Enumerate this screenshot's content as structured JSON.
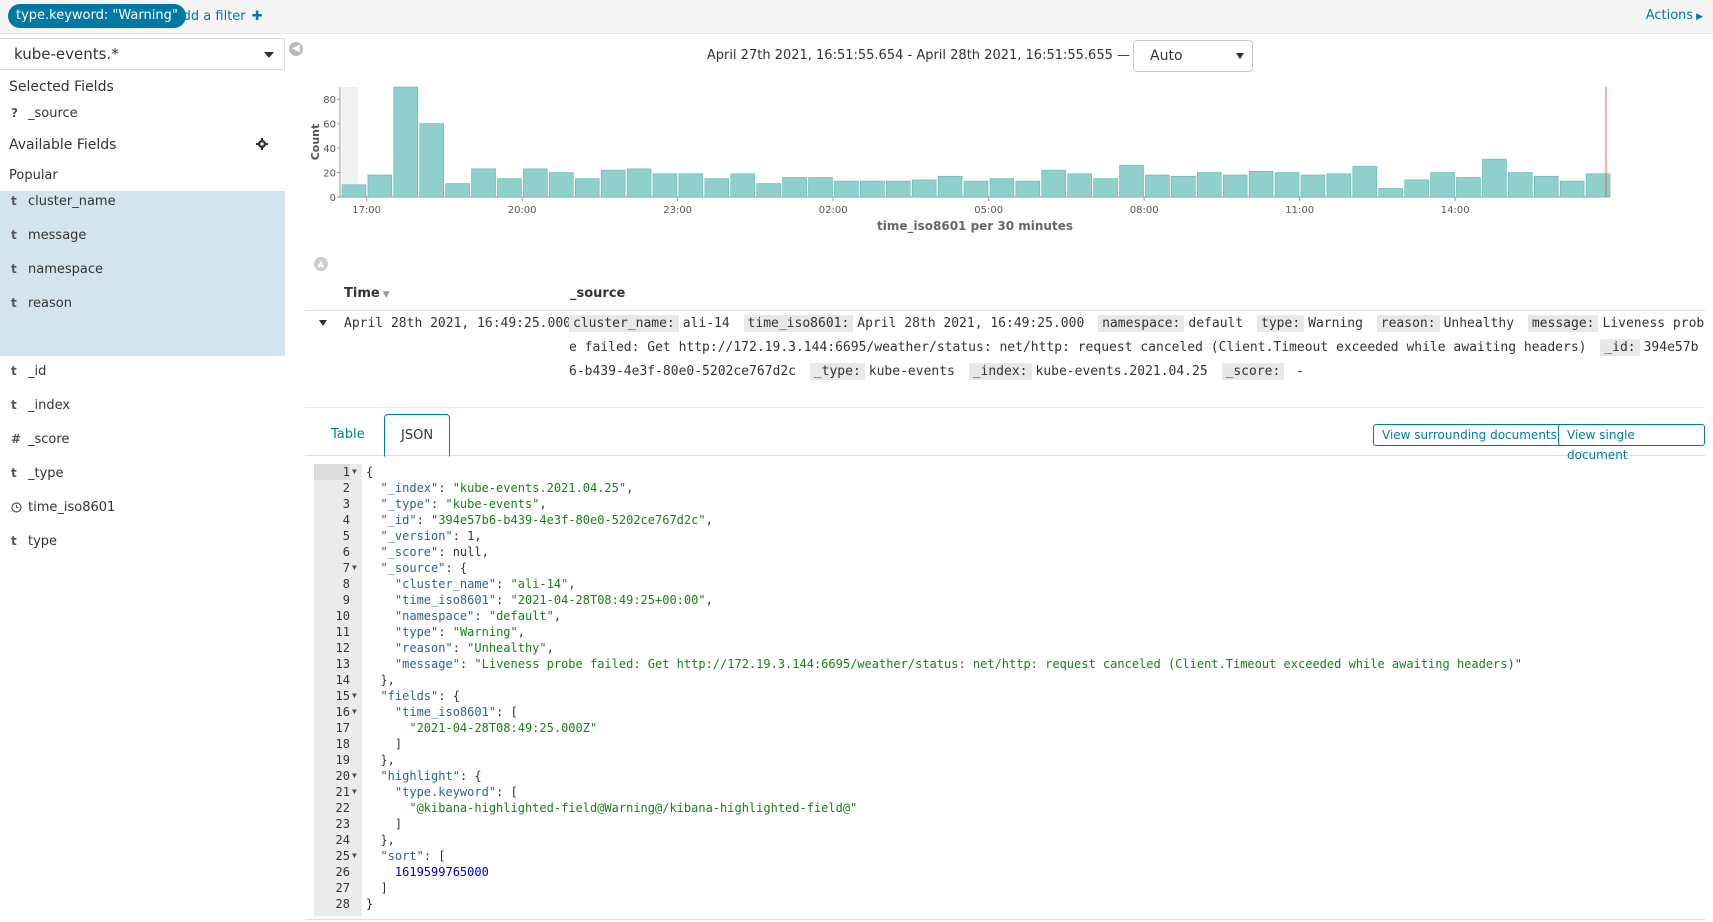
{
  "filterbar": {
    "filter_pill": "type.keyword: \"Warning\"",
    "add_filter": "Add a filter",
    "actions": "Actions"
  },
  "sidebar": {
    "index_pattern": "kube-events.*",
    "selected_title": "Selected Fields",
    "selected_fields": [
      {
        "type": "?",
        "name": "_source"
      }
    ],
    "available_title": "Available Fields",
    "popular_title": "Popular",
    "popular_fields": [
      {
        "type": "t",
        "name": "cluster_name"
      },
      {
        "type": "t",
        "name": "message"
      },
      {
        "type": "t",
        "name": "namespace"
      },
      {
        "type": "t",
        "name": "reason"
      }
    ],
    "other_fields": [
      {
        "type": "t",
        "name": "_id"
      },
      {
        "type": "t",
        "name": "_index"
      },
      {
        "type": "#",
        "name": "_score"
      },
      {
        "type": "t",
        "name": "_type"
      },
      {
        "type": "clock",
        "name": "time_iso8601"
      },
      {
        "type": "t",
        "name": "type"
      }
    ]
  },
  "header": {
    "time_range": "April 27th 2021, 16:51:55.654 - April 28th 2021, 16:51:55.655 —",
    "interval": "Auto"
  },
  "chart_data": {
    "type": "bar",
    "ylabel": "Count",
    "xlabel": "time_iso8601 per 30 minutes",
    "ylim": [
      0,
      90
    ],
    "yticks": [
      0,
      20,
      40,
      60,
      80
    ],
    "xtick_labels": [
      "17:00",
      "20:00",
      "23:00",
      "02:00",
      "05:00",
      "08:00",
      "11:00",
      "14:00"
    ],
    "bar_color": "#8fd0cc",
    "values": [
      10,
      18,
      90,
      60,
      11,
      23,
      15,
      23,
      20,
      15,
      22,
      23,
      19,
      19,
      15,
      19,
      11,
      16,
      16,
      13,
      13,
      13,
      14,
      17,
      13,
      15,
      13,
      22,
      19,
      15,
      26,
      18,
      17,
      20,
      18,
      21,
      20,
      18,
      19,
      25,
      7,
      14,
      20,
      16,
      31,
      20,
      17,
      13,
      19
    ]
  },
  "table": {
    "col_time": "Time",
    "col_source": "_source",
    "row_time": "April 28th 2021, 16:49:25.000",
    "row_source": [
      {
        "k": "cluster_name:",
        "v": "ali-14"
      },
      {
        "k": "time_iso8601:",
        "v": "April 28th 2021, 16:49:25.000"
      },
      {
        "k": "namespace:",
        "v": "default"
      },
      {
        "k": "type:",
        "v": "Warning"
      },
      {
        "k": "reason:",
        "v": "Unhealthy"
      },
      {
        "k": "message:",
        "v": "Liveness probe failed: Get http://172.19.3.144:6695/weather/status: net/http: request canceled (Client.Timeout exceeded while awaiting headers)"
      },
      {
        "k": "_id:",
        "v": "394e57b6-b439-4e3f-80e0-5202ce767d2c"
      },
      {
        "k": "_type:",
        "v": "kube-events"
      },
      {
        "k": "_index:",
        "v": "kube-events.2021.04.25"
      },
      {
        "k": "_score:",
        "v": " -"
      }
    ]
  },
  "detail": {
    "tab_table": "Table",
    "tab_json": "JSON",
    "view_surrounding": "View surrounding documents",
    "view_single": "View single document"
  },
  "json_lines": [
    {
      "n": "1",
      "fold": true,
      "t": "{"
    },
    {
      "n": "2",
      "t": "  \"_index\": \"kube-events.2021.04.25\","
    },
    {
      "n": "3",
      "t": "  \"_type\": \"kube-events\","
    },
    {
      "n": "4",
      "t": "  \"_id\": \"394e57b6-b439-4e3f-80e0-5202ce767d2c\","
    },
    {
      "n": "5",
      "t": "  \"_version\": 1,"
    },
    {
      "n": "6",
      "t": "  \"_score\": null,"
    },
    {
      "n": "7",
      "fold": true,
      "t": "  \"_source\": {"
    },
    {
      "n": "8",
      "t": "    \"cluster_name\": \"ali-14\","
    },
    {
      "n": "9",
      "t": "    \"time_iso8601\": \"2021-04-28T08:49:25+00:00\","
    },
    {
      "n": "10",
      "t": "    \"namespace\": \"default\","
    },
    {
      "n": "11",
      "t": "    \"type\": \"Warning\","
    },
    {
      "n": "12",
      "t": "    \"reason\": \"Unhealthy\","
    },
    {
      "n": "13",
      "t": "    \"message\": \"Liveness probe failed: Get http://172.19.3.144:6695/weather/status: net/http: request canceled (Client.Timeout exceeded while awaiting headers)\""
    },
    {
      "n": "14",
      "t": "  },"
    },
    {
      "n": "15",
      "fold": true,
      "t": "  \"fields\": {"
    },
    {
      "n": "16",
      "fold": true,
      "t": "    \"time_iso8601\": ["
    },
    {
      "n": "17",
      "t": "      \"2021-04-28T08:49:25.000Z\""
    },
    {
      "n": "18",
      "t": "    ]"
    },
    {
      "n": "19",
      "t": "  },"
    },
    {
      "n": "20",
      "fold": true,
      "t": "  \"highlight\": {"
    },
    {
      "n": "21",
      "fold": true,
      "t": "    \"type.keyword\": ["
    },
    {
      "n": "22",
      "t": "      \"@kibana-highlighted-field@Warning@/kibana-highlighted-field@\""
    },
    {
      "n": "23",
      "t": "    ]"
    },
    {
      "n": "24",
      "t": "  },"
    },
    {
      "n": "25",
      "fold": true,
      "t": "  \"sort\": ["
    },
    {
      "n": "26",
      "t": "    1619599765000"
    },
    {
      "n": "27",
      "t": "  ]"
    },
    {
      "n": "28",
      "t": "}"
    }
  ]
}
